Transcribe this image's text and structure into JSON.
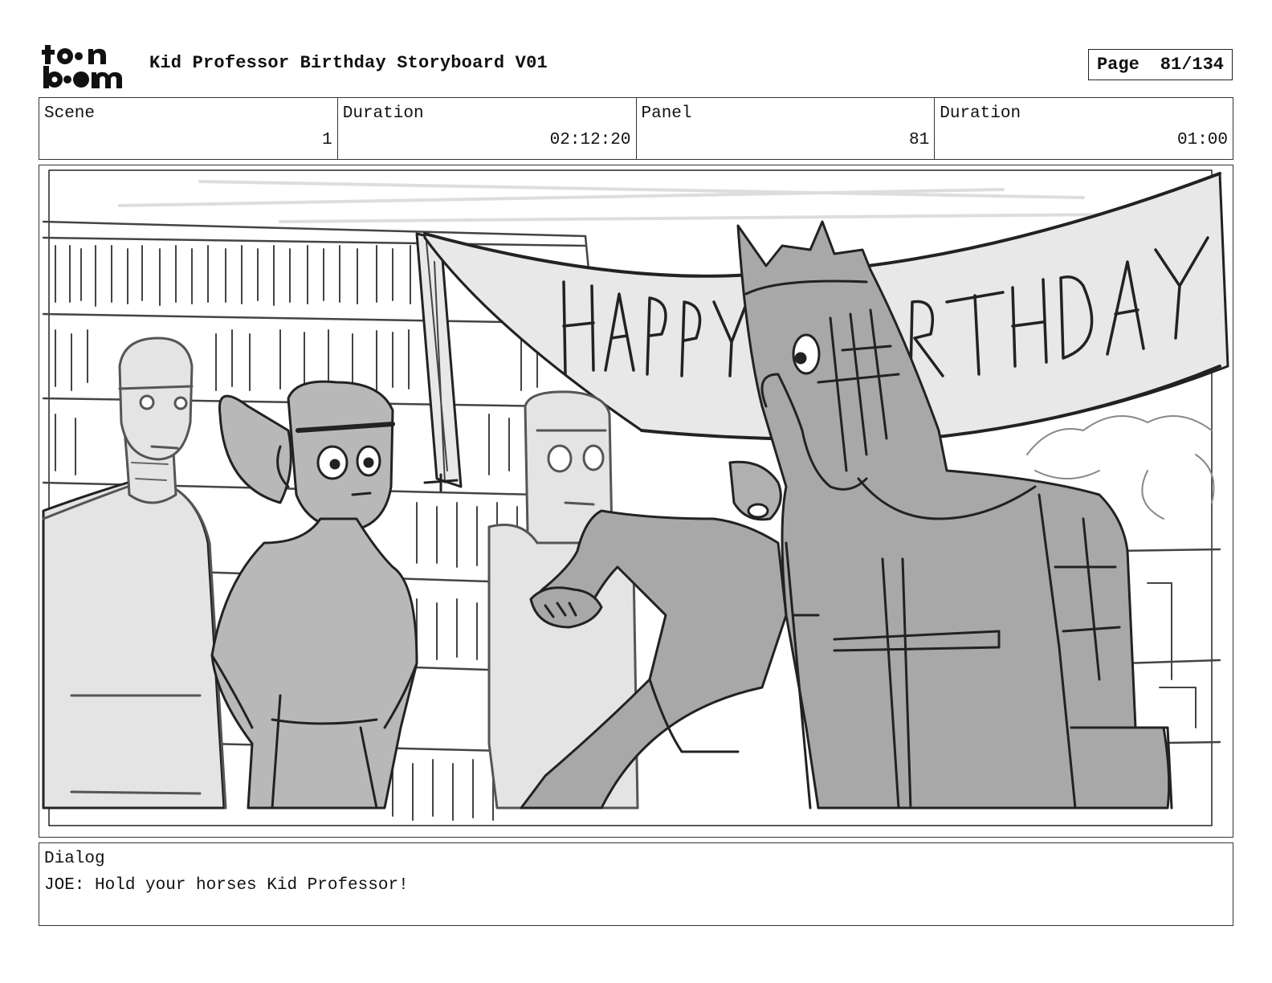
{
  "header": {
    "logo_text": "toon boom",
    "title": "Kid Professor Birthday Storyboard V01",
    "page_label": "Page",
    "page_value": "81/134"
  },
  "info": {
    "scene_label": "Scene",
    "scene_value": "1",
    "scene_duration_label": "Duration",
    "scene_duration_value": "02:12:20",
    "panel_label": "Panel",
    "panel_value": "81",
    "panel_duration_label": "Duration",
    "panel_duration_value": "01:00"
  },
  "panel_image": {
    "banner_text": "HAPPY BIRTHDAY"
  },
  "dialog": {
    "label": "Dialog",
    "text": "JOE: Hold your horses Kid Professor!"
  },
  "colors": {
    "sketch_dark": "#222222",
    "fill_mid": "#a9a9a9",
    "fill_light": "#d2d2d2",
    "fill_pale": "#e8e8e8"
  }
}
